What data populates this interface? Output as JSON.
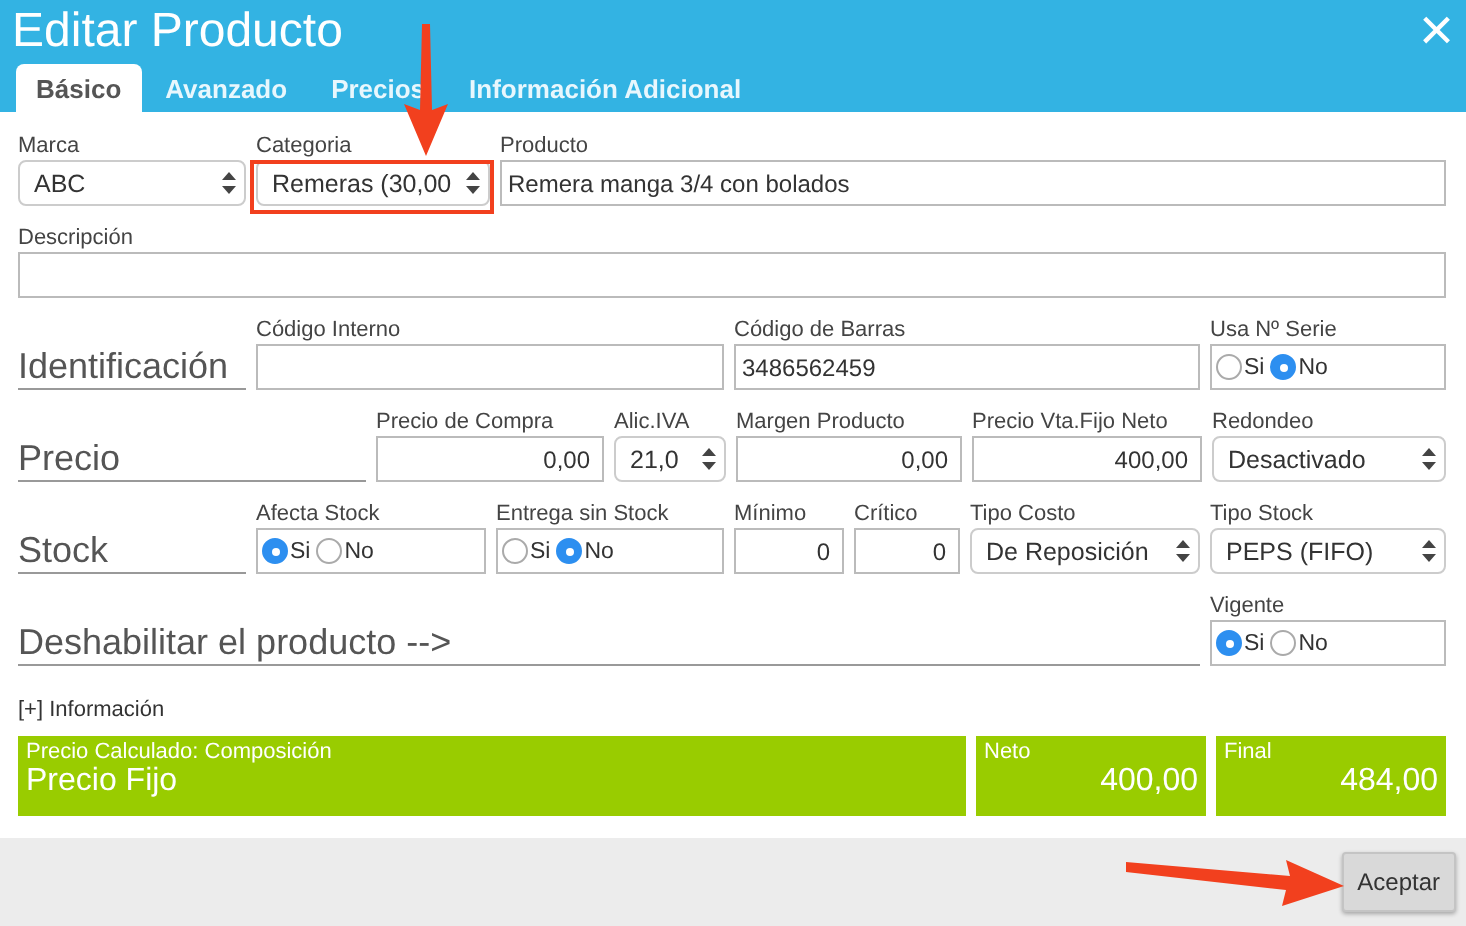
{
  "window": {
    "title": "Editar Producto",
    "close": "×"
  },
  "tabs": [
    {
      "label": "Básico",
      "selected": true
    },
    {
      "label": "Avanzado",
      "selected": false
    },
    {
      "label": "Precios",
      "selected": false
    },
    {
      "label": "Información Adicional",
      "selected": false
    }
  ],
  "rows": [
    [
      {
        "kind": "select",
        "label": "Marca",
        "value": "ABC"
      },
      {
        "kind": "select",
        "label": "Categoria",
        "value": "Remeras (30,00"
      },
      {
        "kind": "text",
        "label": "Producto",
        "value": "Remera manga 3/4 con bolados"
      }
    ],
    [
      {
        "kind": "text",
        "label": "Descripción"
      }
    ],
    [
      {
        "kind": "section",
        "text": "Identificación"
      },
      {
        "kind": "text",
        "label": "Código Interno"
      },
      {
        "kind": "text",
        "label": "Código de Barras",
        "value": "3486562459"
      },
      {
        "kind": "radio",
        "label": "Usa Nº Serie",
        "options": [
          {
            "label": "Si",
            "selected": false
          },
          {
            "label": "No",
            "selected": true
          }
        ]
      }
    ],
    [
      {
        "kind": "section",
        "text": "Precio"
      },
      {
        "kind": "number",
        "label": "Precio de Compra",
        "value": "0,00"
      },
      {
        "kind": "select",
        "label": "Alic.IVA",
        "value": "21,0"
      },
      {
        "kind": "number",
        "label": "Margen Producto",
        "value": "0,00"
      },
      {
        "kind": "number",
        "label": "Precio Vta.Fijo Neto",
        "value": "400,00"
      },
      {
        "kind": "select",
        "label": "Redondeo",
        "value": "Desactivado"
      }
    ],
    [
      {
        "kind": "section",
        "text": "Stock"
      },
      {
        "kind": "radio",
        "label": "Afecta Stock",
        "options": [
          {
            "label": "Si",
            "selected": true
          },
          {
            "label": "No",
            "selected": false
          }
        ]
      },
      {
        "kind": "radio",
        "label": "Entrega sin Stock",
        "options": [
          {
            "label": "Si",
            "selected": false
          },
          {
            "label": "No",
            "selected": true
          }
        ]
      },
      {
        "kind": "number",
        "label": "Mínimo",
        "value": "0"
      },
      {
        "kind": "number",
        "label": "Crítico",
        "value": "0"
      },
      {
        "kind": "select",
        "label": "Tipo Costo",
        "value": "De Reposición"
      },
      {
        "kind": "select",
        "label": "Tipo Stock",
        "value": "PEPS (FIFO)"
      }
    ],
    [
      {
        "kind": "section",
        "text": "Deshabilitar el producto -->"
      },
      {
        "kind": "radio",
        "label": "Vigente",
        "options": [
          {
            "label": "Si",
            "selected": true
          },
          {
            "label": "No",
            "selected": false
          }
        ]
      }
    ]
  ],
  "info_link": "[+] Información",
  "summary": [
    {
      "label": "Precio Calculado: Composición",
      "value": "Precio Fijo"
    },
    {
      "label": "Neto",
      "value": "400,00"
    },
    {
      "label": "Final",
      "value": "484,00"
    }
  ],
  "buttons": [
    "Aceptar"
  ]
}
